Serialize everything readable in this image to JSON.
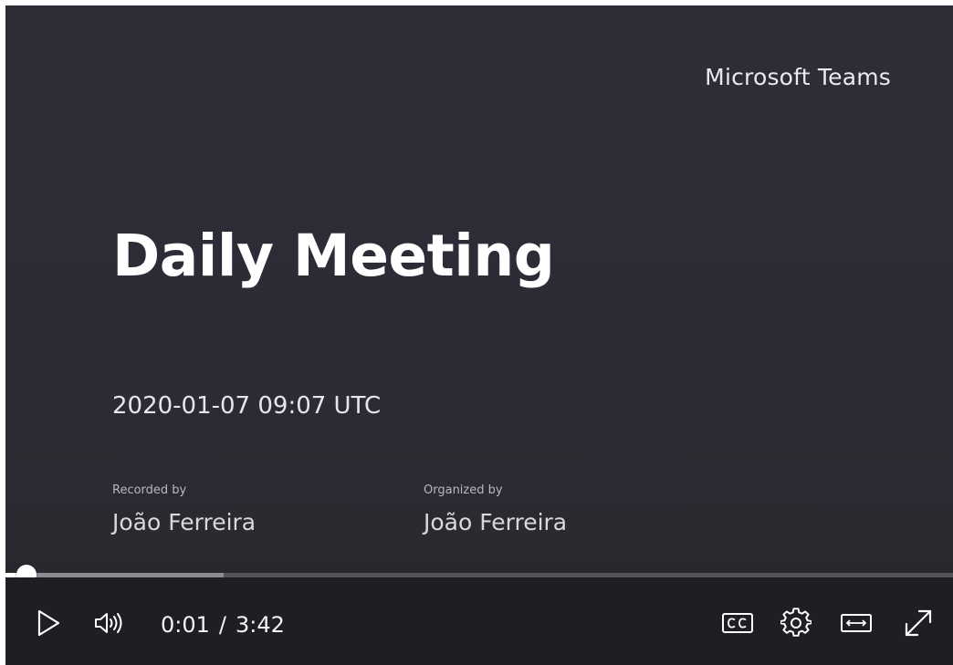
{
  "slide": {
    "brand": "Microsoft Teams",
    "title": "Daily Meeting",
    "datetime": "2020-01-07 09:07 UTC",
    "recorded_by_label": "Recorded by",
    "recorded_by": "João Ferreira",
    "organized_by_label": "Organized by",
    "organized_by": "João Ferreira"
  },
  "player": {
    "current_time": "0:01",
    "separator": "/",
    "duration": "3:42",
    "played_fraction": 0.005,
    "buffered_fraction": 0.23,
    "icons": [
      "play-icon",
      "volume-icon",
      "closed-captions-icon",
      "settings-icon",
      "fit-width-icon",
      "fullscreen-icon"
    ]
  }
}
